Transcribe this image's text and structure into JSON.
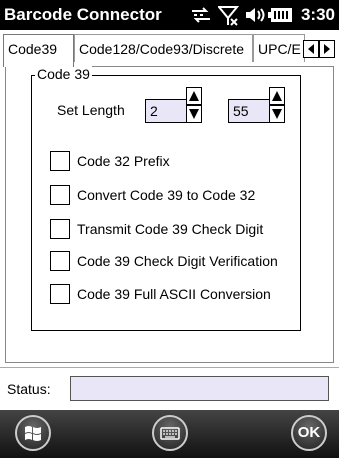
{
  "window": {
    "title": "Barcode Connector",
    "clock": "3:30"
  },
  "status_icons": [
    "data-sync-icon",
    "no-signal-icon",
    "volume-icon",
    "battery-icon"
  ],
  "tabs": [
    {
      "label": "Code39",
      "active": true
    },
    {
      "label": "Code128/Code93/Discrete",
      "active": false
    },
    {
      "label": "UPC/E",
      "active": false
    }
  ],
  "group": {
    "title": "Code 39",
    "set_length_label": "Set Length",
    "min_length": "2",
    "max_length": "55",
    "options": [
      {
        "label": "Code 32 Prefix",
        "checked": false
      },
      {
        "label": "Convert Code 39 to Code 32",
        "checked": false
      },
      {
        "label": "Transmit Code 39 Check Digit",
        "checked": false
      },
      {
        "label": "Code 39 Check Digit Verification",
        "checked": false
      },
      {
        "label": "Code 39 Full ASCII Conversion",
        "checked": false
      }
    ]
  },
  "status": {
    "label": "Status:",
    "value": ""
  },
  "bottom": {
    "ok_label": "OK"
  },
  "colors": {
    "titlebar": "#000000",
    "field_fill": "#e8e6f7",
    "background": "#ffffff"
  }
}
